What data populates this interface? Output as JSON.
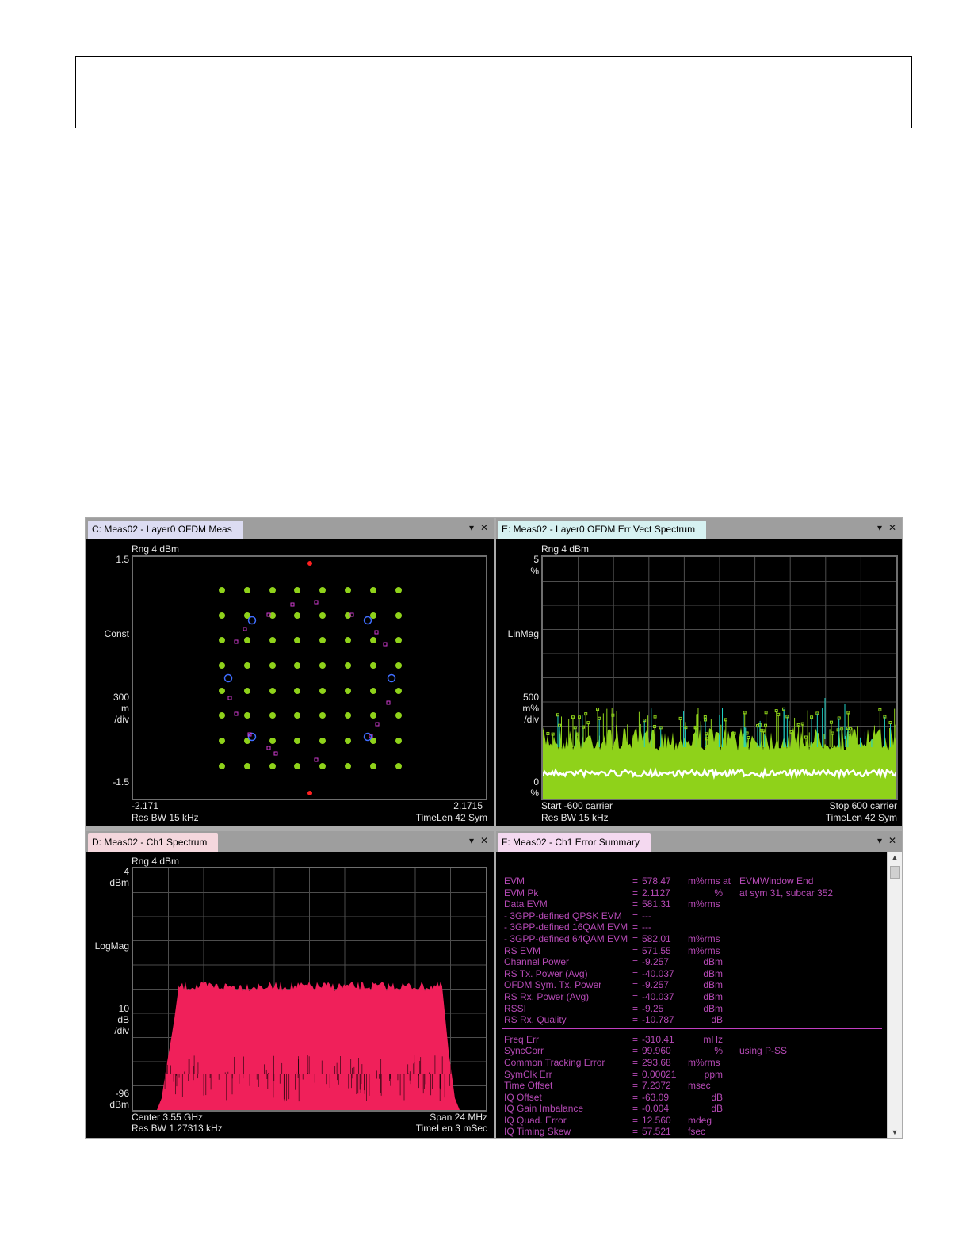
{
  "panes": {
    "constellation": {
      "title": "C: Meas02 - Layer0 OFDM Meas",
      "range": "Rng 4 dBm",
      "y_top": "1.5",
      "y_bottom": "-1.5",
      "y_mode": "Const",
      "y_scale": [
        "300",
        "m",
        "/div"
      ],
      "x_left": "-2.171",
      "x_right": "2.1715",
      "res_bw": "Res BW 15 kHz",
      "time_len": "TimeLen 42  Sym",
      "colors": {
        "qam_points": "#8fd21a",
        "reference": "#ff2020",
        "pilots": "#3f6dff",
        "other": "#d13cd1"
      }
    },
    "err_vect": {
      "title": "E: Meas02 - Layer0 OFDM Err Vect Spectrum",
      "range": "Rng 4 dBm",
      "y_top": [
        "5",
        "%"
      ],
      "y_mode": "LinMag",
      "y_scale": [
        "500",
        "m%",
        "/div"
      ],
      "y_bottom": [
        "0",
        "%"
      ],
      "start": "Start -600  carrier",
      "stop": "Stop 600  carrier",
      "res_bw": "Res BW 15 kHz",
      "time_len": "TimeLen 42  Sym",
      "colors": {
        "fill": "#8fd21a",
        "cyan": "#1fd3c8",
        "avg": "#ffffff"
      }
    },
    "spectrum": {
      "title": "D: Meas02 - Ch1 Spectrum",
      "range": "Rng 4 dBm",
      "y_top": [
        "4",
        "dBm"
      ],
      "y_mode": "LogMag",
      "y_scale": [
        "10",
        "dB",
        "/div"
      ],
      "y_bottom": [
        "-96",
        "dBm"
      ],
      "center": "Center 3.55 GHz",
      "span": "Span 24 MHz",
      "res_bw": "Res BW 1.27313 kHz",
      "time_len": "TimeLen 3 mSec",
      "colors": {
        "trace": "#f0205a"
      }
    },
    "summary": {
      "title": "F: Meas02 - Ch1 Error Summary",
      "rows": [
        {
          "label": "EVM",
          "eq": "=",
          "value": "578.47",
          "unit": "m%rms at",
          "extra": "EVMWindow End"
        },
        {
          "label": "EVM Pk",
          "eq": "=",
          "value": "2.1127",
          "unit": "%",
          "extra": "at   sym 31,   subcar  352"
        },
        {
          "label": "Data EVM",
          "eq": "=",
          "value": "581.31",
          "unit": "m%rms",
          "extra": ""
        },
        {
          "label": " - 3GPP-defined QPSK EVM",
          "eq": "=",
          "value": "---",
          "unit": "",
          "extra": ""
        },
        {
          "label": " - 3GPP-defined 16QAM EVM",
          "eq": "=",
          "value": "---",
          "unit": "",
          "extra": ""
        },
        {
          "label": " - 3GPP-defined 64QAM EVM",
          "eq": "=",
          "value": "582.01",
          "unit": "m%rms",
          "extra": ""
        },
        {
          "label": "RS EVM",
          "eq": "=",
          "value": "571.55",
          "unit": "m%rms",
          "extra": ""
        },
        {
          "label": "Channel Power",
          "eq": "=",
          "value": "-9.257",
          "unit": "dBm",
          "extra": ""
        },
        {
          "label": "RS Tx. Power (Avg)",
          "eq": "=",
          "value": "-40.037",
          "unit": "dBm",
          "extra": ""
        },
        {
          "label": "OFDM Sym. Tx. Power",
          "eq": "=",
          "value": "-9.257",
          "unit": "dBm",
          "extra": ""
        },
        {
          "label": "RS Rx. Power (Avg)",
          "eq": "=",
          "value": "-40.037",
          "unit": "dBm",
          "extra": ""
        },
        {
          "label": "RSSI",
          "eq": "=",
          "value": "-9.25",
          "unit": "dBm",
          "extra": ""
        },
        {
          "label": "RS Rx. Quality",
          "eq": "=",
          "value": "-10.787",
          "unit": "dB",
          "extra": ""
        }
      ],
      "rows2": [
        {
          "label": "Freq Err",
          "eq": "=",
          "value": "-310.41",
          "unit": "mHz",
          "extra": ""
        },
        {
          "label": "SyncCorr",
          "eq": "=",
          "value": "99.960",
          "unit": "%",
          "extra": "using   P-SS"
        },
        {
          "label": "Common Tracking Error",
          "eq": "=",
          "value": "293.68",
          "unit": "m%rms",
          "extra": ""
        },
        {
          "label": "SymClk Err",
          "eq": "=",
          "value": "0.00021",
          "unit": "ppm",
          "extra": ""
        },
        {
          "label": "Time Offset",
          "eq": "=",
          "value": "7.2372",
          "unit": "msec",
          "extra": ""
        },
        {
          "label": "IQ Offset",
          "eq": "=",
          "value": "-63.09",
          "unit": "dB",
          "extra": ""
        },
        {
          "label": "IQ Gain Imbalance",
          "eq": "=",
          "value": "-0.004",
          "unit": "dB",
          "extra": ""
        },
        {
          "label": "IQ Quad. Error",
          "eq": "=",
          "value": "12.560",
          "unit": "mdeg",
          "extra": ""
        },
        {
          "label": "IQ Timing Skew",
          "eq": "=",
          "value": "57.521",
          "unit": "fsec",
          "extra": ""
        }
      ],
      "colors": {
        "text": "#b64ab6"
      }
    }
  },
  "icons": {
    "dropdown": "▾",
    "close": "✕",
    "scroll_up": "▲",
    "scroll_down": "▼"
  }
}
